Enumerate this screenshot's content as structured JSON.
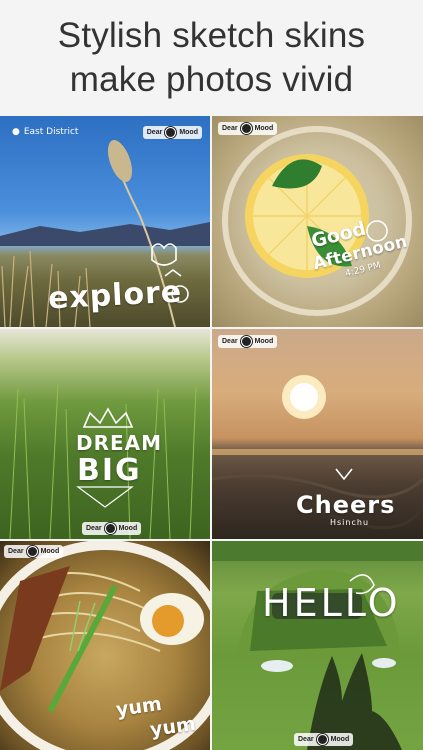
{
  "header": {
    "line1": "Stylish sketch skins",
    "line2": "make photos vivid"
  },
  "logo": {
    "text_left": "Dear",
    "text_right": "Mood"
  },
  "tiles": [
    {
      "location": "East District",
      "sticker": "explore"
    },
    {
      "sticker_line1": "Good",
      "sticker_line2": "Afternoon",
      "time": "4:29 PM"
    },
    {
      "sticker_line1": "DREAM",
      "sticker_line2": "BIG"
    },
    {
      "sticker": "Cheers",
      "caption": "Hsinchu"
    },
    {
      "sticker_line1": "yum",
      "sticker_line2": "yum"
    },
    {
      "sticker": "HELLO"
    }
  ],
  "colors": {
    "background": "#f4f4f4",
    "headline_text": "#333333",
    "sticker_text": "#ffffff"
  }
}
